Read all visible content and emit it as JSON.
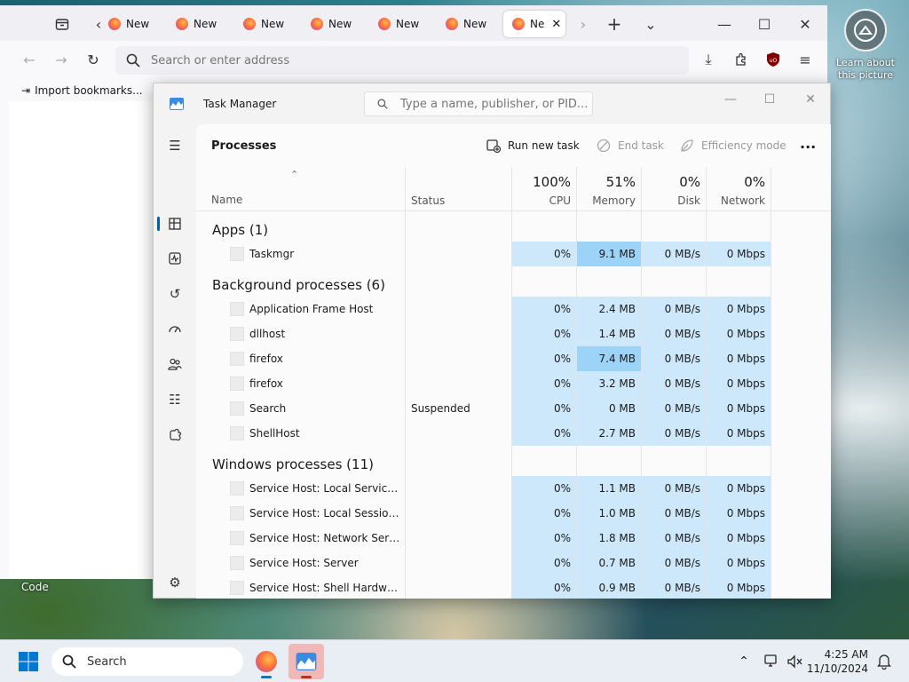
{
  "desktop": {
    "widget_label": "Learn about this picture",
    "bottom_label": "Code"
  },
  "firefox": {
    "tabs": [
      "New",
      "New",
      "New",
      "New",
      "New",
      "New",
      "New",
      "Ne"
    ],
    "active_tab_index": 7,
    "url_placeholder": "Search or enter address",
    "bookmarks_import_label": "Import bookmarks..."
  },
  "task_manager": {
    "title": "Task Manager",
    "search_placeholder": "Type a name, publisher, or PID...",
    "page_title": "Processes",
    "actions": {
      "run_new_task": "Run new task",
      "end_task": "End task",
      "efficiency_mode": "Efficiency mode",
      "more": "..."
    },
    "columns": {
      "name": "Name",
      "status": "Status",
      "cpu_pct": "100%",
      "cpu": "CPU",
      "memory_pct": "51%",
      "memory": "Memory",
      "disk_pct": "0%",
      "disk": "Disk",
      "network_pct": "0%",
      "network": "Network"
    },
    "groups": [
      {
        "label": "Apps (1)",
        "rows": [
          {
            "name": "Taskmgr",
            "status": "",
            "cpu": "0%",
            "memory": "9.1 MB",
            "disk": "0 MB/s",
            "network": "0 Mbps",
            "mem_hot": true
          }
        ]
      },
      {
        "label": "Background processes (6)",
        "rows": [
          {
            "name": "Application Frame Host",
            "status": "",
            "cpu": "0%",
            "memory": "2.4 MB",
            "disk": "0 MB/s",
            "network": "0 Mbps",
            "mem_hot": false
          },
          {
            "name": "dllhost",
            "status": "",
            "cpu": "0%",
            "memory": "1.4 MB",
            "disk": "0 MB/s",
            "network": "0 Mbps",
            "mem_hot": false
          },
          {
            "name": "firefox",
            "status": "",
            "cpu": "0%",
            "memory": "7.4 MB",
            "disk": "0 MB/s",
            "network": "0 Mbps",
            "mem_hot": true
          },
          {
            "name": "firefox",
            "status": "",
            "cpu": "0%",
            "memory": "3.2 MB",
            "disk": "0 MB/s",
            "network": "0 Mbps",
            "mem_hot": false
          },
          {
            "name": "Search",
            "status": "Suspended",
            "cpu": "0%",
            "memory": "0 MB",
            "disk": "0 MB/s",
            "network": "0 Mbps",
            "mem_hot": false
          },
          {
            "name": "ShellHost",
            "status": "",
            "cpu": "0%",
            "memory": "2.7 MB",
            "disk": "0 MB/s",
            "network": "0 Mbps",
            "mem_hot": false
          }
        ]
      },
      {
        "label": "Windows processes (11)",
        "rows": [
          {
            "name": "Service Host: Local Service (N...",
            "status": "",
            "cpu": "0%",
            "memory": "1.1 MB",
            "disk": "0 MB/s",
            "network": "0 Mbps",
            "mem_hot": false
          },
          {
            "name": "Service Host: Local Session M...",
            "status": "",
            "cpu": "0%",
            "memory": "1.0 MB",
            "disk": "0 MB/s",
            "network": "0 Mbps",
            "mem_hot": false
          },
          {
            "name": "Service Host: Network Service",
            "status": "",
            "cpu": "0%",
            "memory": "1.8 MB",
            "disk": "0 MB/s",
            "network": "0 Mbps",
            "mem_hot": false
          },
          {
            "name": "Service Host: Server",
            "status": "",
            "cpu": "0%",
            "memory": "0.7 MB",
            "disk": "0 MB/s",
            "network": "0 Mbps",
            "mem_hot": false
          },
          {
            "name": "Service Host: Shell Hardware ...",
            "status": "",
            "cpu": "0%",
            "memory": "0.9 MB",
            "disk": "0 MB/s",
            "network": "0 Mbps",
            "mem_hot": false
          }
        ]
      }
    ],
    "sidebar_icons": [
      "hamburger-icon",
      "processes-icon",
      "performance-icon",
      "app-history-icon",
      "startup-apps-icon",
      "users-icon",
      "details-icon",
      "services-icon",
      "settings-icon"
    ]
  },
  "taskbar": {
    "search_label": "Search",
    "time": "4:25 AM",
    "date": "11/10/2024"
  },
  "colors": {
    "accent": "#005fb8",
    "heat_light": "#cde8fb",
    "heat_strong": "#9dd3f7",
    "firefox_orange": "#ff7139"
  }
}
